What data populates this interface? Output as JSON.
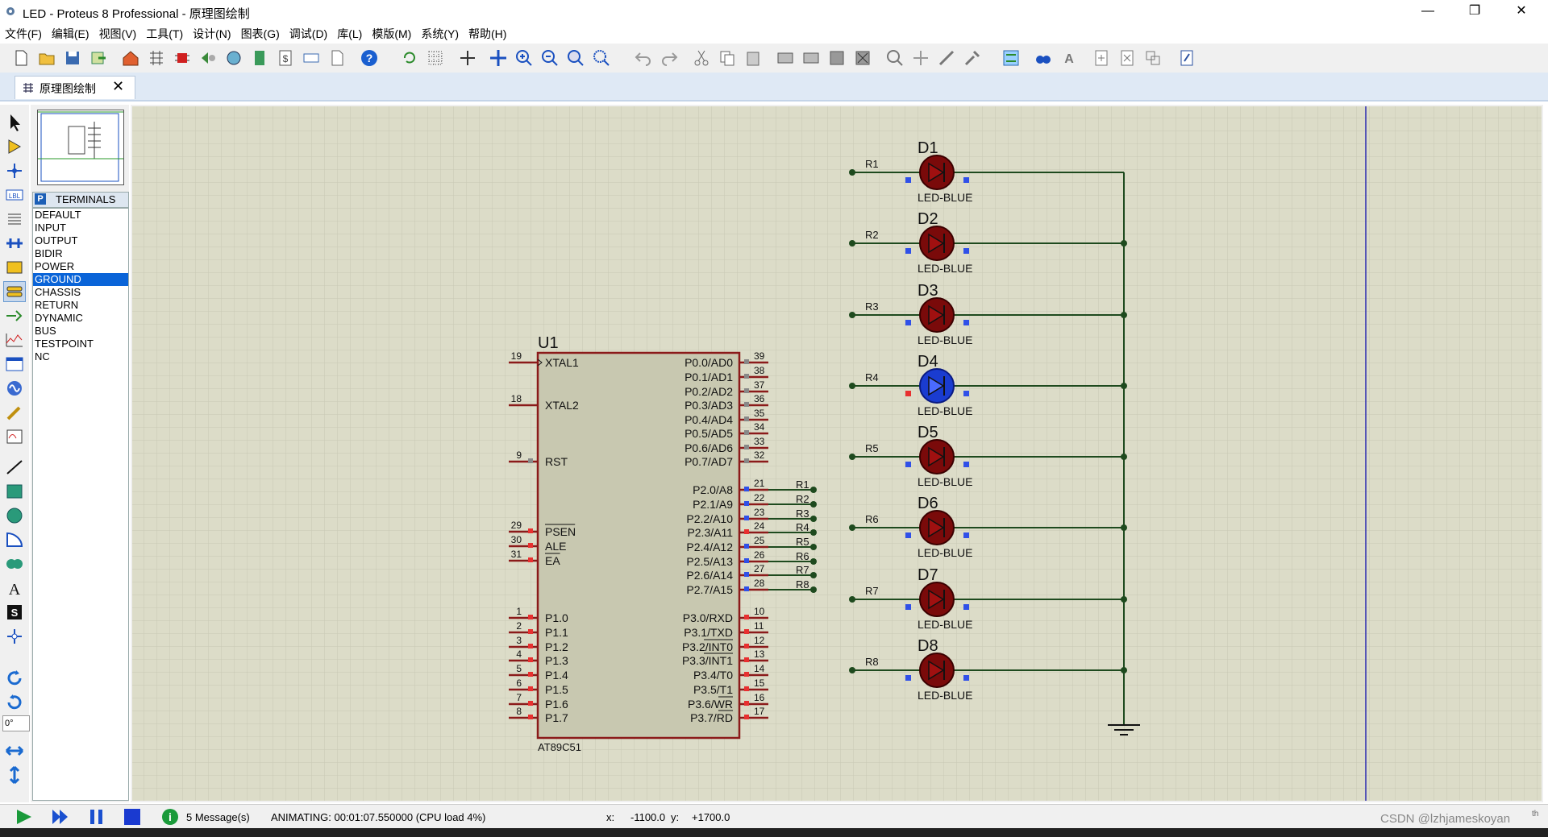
{
  "window": {
    "title": "LED - Proteus 8 Professional - 原理图绘制",
    "minimize": "—",
    "restore": "❐",
    "close": "✕"
  },
  "menu": [
    "文件(F)",
    "编辑(E)",
    "视图(V)",
    "工具(T)",
    "设计(N)",
    "图表(G)",
    "调试(D)",
    "库(L)",
    "模版(M)",
    "系统(Y)",
    "帮助(H)"
  ],
  "tab": {
    "label": "原理图绘制",
    "close": "✕"
  },
  "terminals": {
    "mode": "P",
    "header": "TERMINALS",
    "items": [
      "DEFAULT",
      "INPUT",
      "OUTPUT",
      "BIDIR",
      "POWER",
      "GROUND",
      "CHASSIS",
      "RETURN",
      "DYNAMIC",
      "BUS",
      "TESTPOINT",
      "NC"
    ],
    "selected": "GROUND"
  },
  "rotation": "0°",
  "schematic": {
    "chip": {
      "ref": "U1",
      "part": "AT89C51",
      "left_pins": [
        {
          "num": "19",
          "name": "XTAL1"
        },
        {
          "num": "18",
          "name": "XTAL2"
        },
        {
          "num": "9",
          "name": "RST"
        },
        {
          "num": "29",
          "name": "PSEN"
        },
        {
          "num": "30",
          "name": "ALE"
        },
        {
          "num": "31",
          "name": "EA"
        },
        {
          "num": "1",
          "name": "P1.0"
        },
        {
          "num": "2",
          "name": "P1.1"
        },
        {
          "num": "3",
          "name": "P1.2"
        },
        {
          "num": "4",
          "name": "P1.3"
        },
        {
          "num": "5",
          "name": "P1.4"
        },
        {
          "num": "6",
          "name": "P1.5"
        },
        {
          "num": "7",
          "name": "P1.6"
        },
        {
          "num": "8",
          "name": "P1.7"
        }
      ],
      "right_pins": [
        {
          "num": "39",
          "name": "P0.0/AD0"
        },
        {
          "num": "38",
          "name": "P0.1/AD1"
        },
        {
          "num": "37",
          "name": "P0.2/AD2"
        },
        {
          "num": "36",
          "name": "P0.3/AD3"
        },
        {
          "num": "35",
          "name": "P0.4/AD4"
        },
        {
          "num": "34",
          "name": "P0.5/AD5"
        },
        {
          "num": "33",
          "name": "P0.6/AD6"
        },
        {
          "num": "32",
          "name": "P0.7/AD7"
        },
        {
          "num": "21",
          "name": "P2.0/A8",
          "net": "R1"
        },
        {
          "num": "22",
          "name": "P2.1/A9",
          "net": "R2"
        },
        {
          "num": "23",
          "name": "P2.2/A10",
          "net": "R3"
        },
        {
          "num": "24",
          "name": "P2.3/A11",
          "net": "R4"
        },
        {
          "num": "25",
          "name": "P2.4/A12",
          "net": "R5"
        },
        {
          "num": "26",
          "name": "P2.5/A13",
          "net": "R6"
        },
        {
          "num": "27",
          "name": "P2.6/A14",
          "net": "R7"
        },
        {
          "num": "28",
          "name": "P2.7/A15",
          "net": "R8"
        },
        {
          "num": "10",
          "name": "P3.0/RXD"
        },
        {
          "num": "11",
          "name": "P3.1/TXD"
        },
        {
          "num": "12",
          "name": "P3.2/INT0"
        },
        {
          "num": "13",
          "name": "P3.3/INT1"
        },
        {
          "num": "14",
          "name": "P3.4/T0"
        },
        {
          "num": "15",
          "name": "P3.5/T1"
        },
        {
          "num": "16",
          "name": "P3.6/WR"
        },
        {
          "num": "17",
          "name": "P3.7/RD"
        }
      ]
    },
    "leds": [
      {
        "ref": "D1",
        "net": "R1",
        "value": "LED-BLUE",
        "lit": false
      },
      {
        "ref": "D2",
        "net": "R2",
        "value": "LED-BLUE",
        "lit": false
      },
      {
        "ref": "D3",
        "net": "R3",
        "value": "LED-BLUE",
        "lit": false
      },
      {
        "ref": "D4",
        "net": "R4",
        "value": "LED-BLUE",
        "lit": true
      },
      {
        "ref": "D5",
        "net": "R5",
        "value": "LED-BLUE",
        "lit": false
      },
      {
        "ref": "D6",
        "net": "R6",
        "value": "LED-BLUE",
        "lit": false
      },
      {
        "ref": "D7",
        "net": "R7",
        "value": "LED-BLUE",
        "lit": false
      },
      {
        "ref": "D8",
        "net": "R8",
        "value": "LED-BLUE",
        "lit": false
      }
    ]
  },
  "status": {
    "messages": "5 Message(s)",
    "animating": "ANIMATING: 00:01:07.550000 (CPU load 4%)",
    "x_label": "x:",
    "x_value": "-1100.0",
    "y_label": "y:",
    "y_value": "+1700.0",
    "watermark": "CSDN @lzhjameskoyan",
    "watermark_suffix": "th"
  },
  "colors": {
    "canvas": "#dcdcc8",
    "grid": "#c8c8b4",
    "chip_fill": "#c8c8b0",
    "chip_border": "#8b1a1a",
    "wire": "#1e4a1e",
    "led_off": "#7a0a0a",
    "led_on": "#1a3cd0",
    "pin_red": "#e83030",
    "pin_blue": "#3050e8",
    "pin_grey": "#888888"
  }
}
